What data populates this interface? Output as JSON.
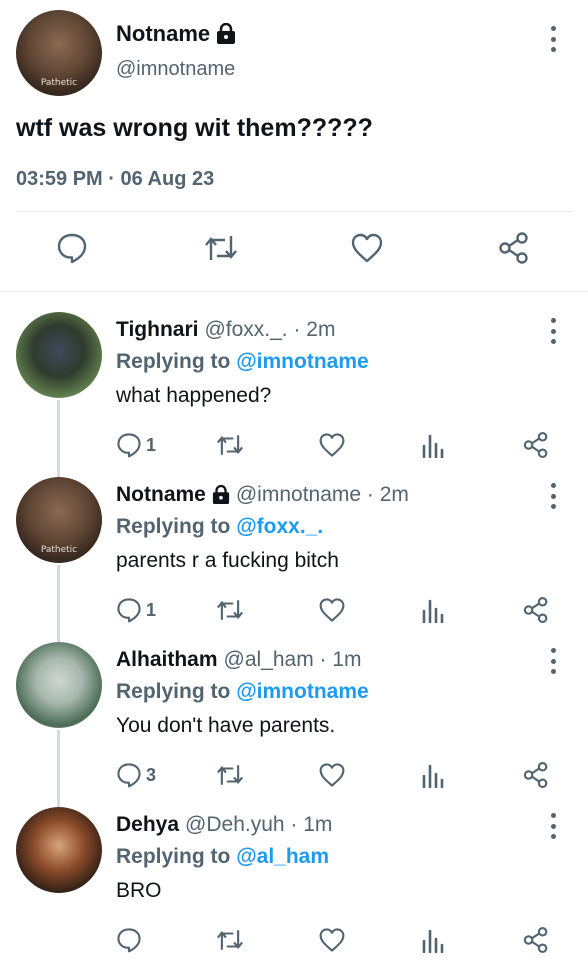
{
  "main_tweet": {
    "name": "Notname",
    "handle": "@imnotname",
    "avatar_caption": "Pathetic",
    "text": "wtf was wrong wit them?????",
    "timestamp": "03:59 PM · 06 Aug 23",
    "lock_icon": "lock-icon"
  },
  "replies": [
    {
      "name": "Tighnari",
      "handle": "@foxx._. · 2m",
      "replying_prefix": "Replying to",
      "replying_to": "@imnotname",
      "text": "what happened?",
      "reply_count": "1",
      "locked": false
    },
    {
      "name": "Notname",
      "handle": "@imnotname · 2m",
      "avatar_caption": "Pathetic",
      "replying_prefix": "Replying to",
      "replying_to": "@foxx._.",
      "text": "parents r a fucking bitch",
      "reply_count": "1",
      "locked": true
    },
    {
      "name": "Alhaitham",
      "handle": "@al_ham · 1m",
      "replying_prefix": "Replying to",
      "replying_to": "@imnotname",
      "text": "You don't have parents.",
      "reply_count": "3",
      "locked": false
    },
    {
      "name": "Dehya",
      "handle": "@Deh.yuh · 1m",
      "replying_prefix": "Replying to",
      "replying_to": "@al_ham",
      "text": "BRO",
      "reply_count": "",
      "locked": false
    }
  ],
  "colors": {
    "text": "#0f1419",
    "secondary": "#536471",
    "link": "#1d9bf0",
    "divider": "#e6e9ec",
    "thread_line": "#d7dbde"
  }
}
